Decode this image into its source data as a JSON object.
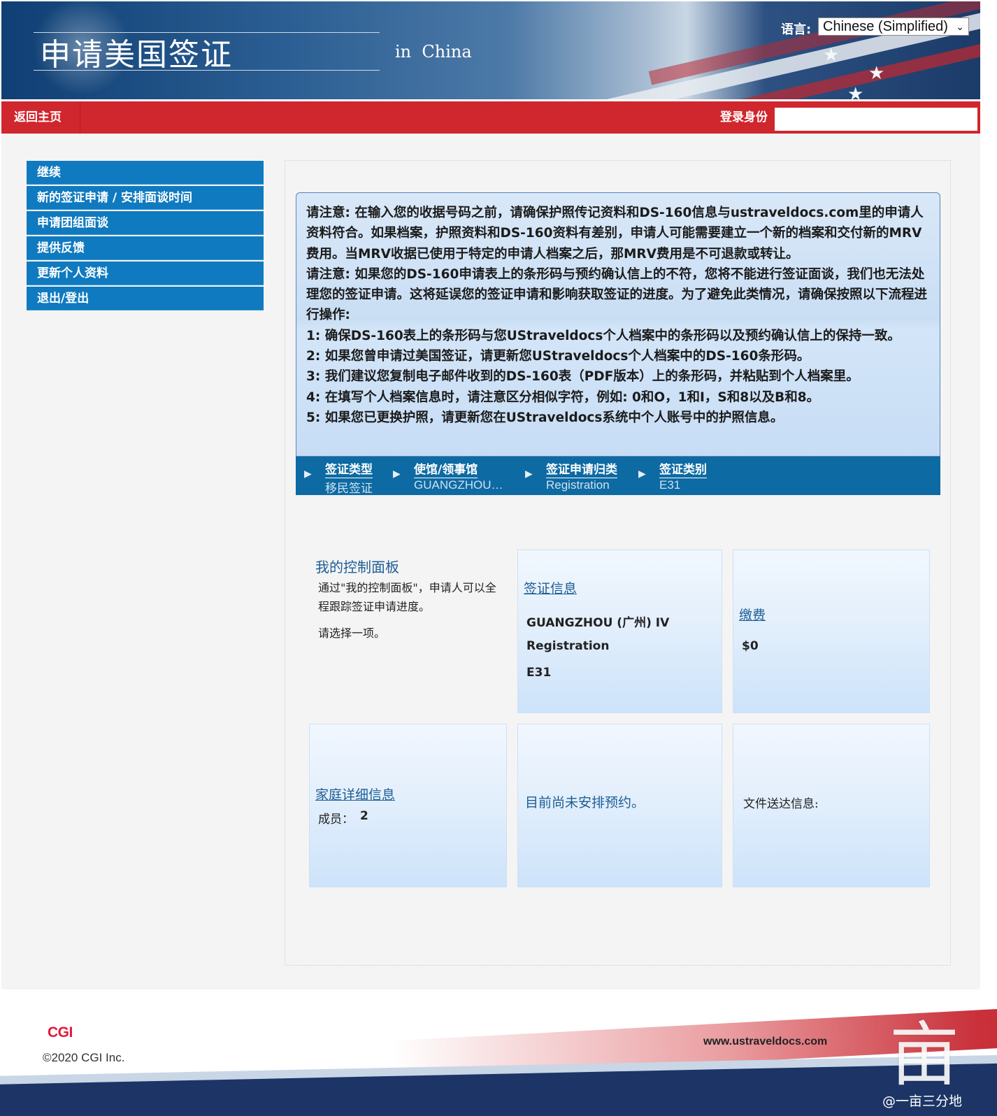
{
  "header": {
    "title": "申请美国签证",
    "subtitle": "in  China",
    "language_label": "语言:",
    "language_value": "Chinese (Simplified)"
  },
  "navbar": {
    "home": "返回主页",
    "login_label": "登录身份",
    "login_value": ""
  },
  "sidebar": {
    "items": [
      {
        "label": "继续"
      },
      {
        "label": "新的签证申请 / 安排面谈时间"
      },
      {
        "label": "申请团组面谈"
      },
      {
        "label": "提供反馈"
      },
      {
        "label": "更新个人资料"
      },
      {
        "label": "退出/登出"
      }
    ]
  },
  "notice": {
    "p1": "请注意: 在输入您的收据号码之前，请确保护照传记资料和DS-160信息与ustraveldocs.com里的申请人资料符合。如果档案，护照资料和DS-160资料有差别，申请人可能需要建立一个新的档案和交付新的MRV费用。当MRV收据已使用于特定的申请人档案之后，那MRV费用是不可退款或转让。",
    "p2": "请注意: 如果您的DS-160申请表上的条形码与预约确认信上的不符，您将不能进行签证面谈，我们也无法处理您的签证申请。这将延误您的签证申请和影响获取签证的进度。为了避免此类情况，请确保按照以下流程进行操作:",
    "s1": "1: 确保DS-160表上的条形码与您UStraveldocs个人档案中的条形码以及预约确认信上的保持一致。",
    "s2": "2: 如果您曾申请过美国签证，请更新您UStraveldocs个人档案中的DS-160条形码。",
    "s3": "3: 我们建议您复制电子邮件收到的DS-160表（PDF版本）上的条形码，并粘贴到个人档案里。",
    "s4": "4: 在填写个人档案信息时，请注意区分相似字符，例如: 0和O，1和I，S和8以及B和8。",
    "s5": "5: 如果您已更换护照，请更新您在UStraveldocs系统中个人账号中的护照信息。"
  },
  "breadcrumbs": [
    {
      "heading": "签证类型",
      "value": "移民签证"
    },
    {
      "heading": "使馆/领事馆",
      "value": "GUANGZHOU…"
    },
    {
      "heading": "签证申请归类",
      "value": "Registration"
    },
    {
      "heading": "签证类别",
      "value": "E31"
    }
  ],
  "dashboard": {
    "title": "我的控制面板",
    "description": "通过\"我的控制面板\"，申请人可以全程跟踪签证申请进度。",
    "prompt": "请选择一项。",
    "visa_info": {
      "link": "签证信息",
      "post": "GUANGZHOU (广州) IV",
      "category": "Registration",
      "class": "E31"
    },
    "payment": {
      "link": "缴费",
      "amount": "$0"
    },
    "family": {
      "link": "家庭详细信息",
      "members_label": "成员：",
      "members_count": "2"
    },
    "appointment": {
      "text": "目前尚未安排预约。"
    },
    "delivery": {
      "text": "文件送达信息:"
    }
  },
  "footer": {
    "logo": "CGI",
    "copyright": "©2020 CGI Inc.",
    "url": "www.ustraveldocs.com",
    "watermark_glyph": "亩",
    "watermark_text": "@一亩三分地"
  }
}
